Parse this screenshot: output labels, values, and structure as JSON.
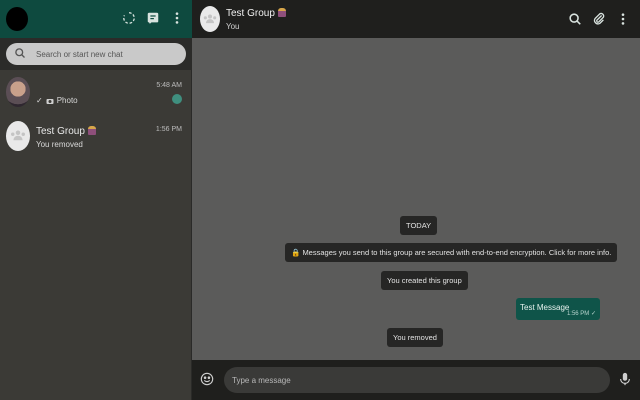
{
  "sidebar": {
    "search": {
      "placeholder": "Search or start new chat"
    },
    "chats": [
      {
        "name": "",
        "time": "5:48 AM",
        "preview_prefix": "✓",
        "preview": "Photo",
        "unread": true
      },
      {
        "name": "Test Group",
        "time": "1:56 PM",
        "preview": "You removed"
      }
    ]
  },
  "header": {
    "title": "Test Group",
    "subtitle": "You"
  },
  "conversation": {
    "date_label": "TODAY",
    "encryption_notice": "Messages you send to this group are secured with end-to-end encryption. Click for more info.",
    "system_created": "You created this group",
    "outgoing": {
      "text": "Test Message",
      "time": "1:56 PM",
      "ticks": "✓"
    },
    "system_removed": "You removed"
  },
  "composer": {
    "placeholder": "Type a message"
  },
  "colors": {
    "accent": "#0e4a3f",
    "outgoing_bubble": "#0f5449",
    "background": "#5b5b5a"
  },
  "icons": [
    "status-icon",
    "new-chat-icon",
    "menu-icon",
    "search-icon",
    "attach-icon",
    "emoji-icon",
    "mic-icon",
    "lock-icon",
    "group-icon",
    "camera-icon"
  ]
}
